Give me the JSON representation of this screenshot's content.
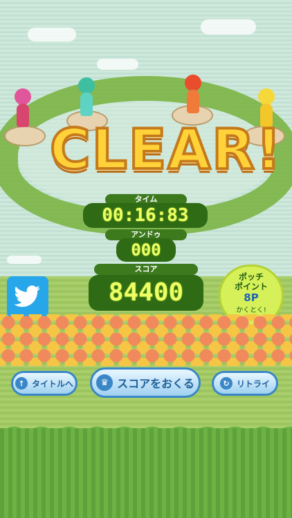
{
  "result": {
    "title": "CLEAR!"
  },
  "stats": {
    "time_label": "タイム",
    "time_value": "00:16:83",
    "undo_label": "アンドゥ",
    "undo_value": "000",
    "score_label": "スコア",
    "score_value": "84400"
  },
  "points_badge": {
    "label": "ポッチ\nポイント",
    "value": "8P",
    "sub": "かくとく!"
  },
  "buttons": {
    "title": "タイトルへ",
    "send_score": "スコアをおくる",
    "retry": "リトライ"
  },
  "colors": {
    "clear_fill": "#ffd23a",
    "value_text": "#eeff66",
    "button_border": "#3a86c6",
    "twitter": "#27a6ea"
  },
  "icons": {
    "twitter": "twitter-bird-icon",
    "title_button": "up-arrow-icon",
    "send_score_button": "crown-icon",
    "retry_button": "refresh-icon"
  }
}
